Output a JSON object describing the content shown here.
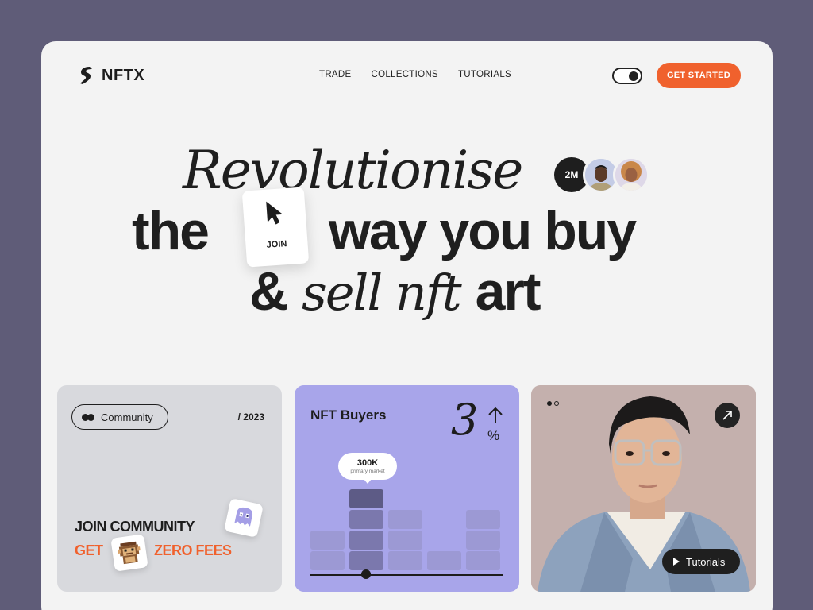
{
  "brand": {
    "name": "NFTX"
  },
  "nav": {
    "items": [
      "TRADE",
      "COLLECTIONS",
      "TUTORIALS"
    ]
  },
  "header": {
    "cta_label": "GET STARTED",
    "theme_toggle_state": "on"
  },
  "hero": {
    "line1": "Revolutionise",
    "line2_start": "the",
    "line2_end": "way you buy",
    "line3_start": "&",
    "line3_italic": "sell nft",
    "line3_end": "art",
    "join_label": "JOIN",
    "users_badge": "2M"
  },
  "community_card": {
    "pill_label": "Community",
    "year": "/ 2023",
    "title": "JOIN COMMUNITY",
    "get": "GET",
    "zero_fees": "ZERO FEES"
  },
  "buyers_card": {
    "title": "NFT Buyers",
    "stat_number": "3",
    "stat_unit": "%",
    "tooltip_value": "300K",
    "tooltip_label": "primary market",
    "columns_blocks": [
      2,
      4,
      3,
      1,
      3
    ],
    "highlight_column": 1,
    "slider_position": 0.29
  },
  "tutorials_card": {
    "button_label": "Tutorials",
    "carousel_index": 0,
    "carousel_count": 2
  },
  "colors": {
    "background": "#5f5c78",
    "accent": "#f0612d",
    "card_community": "#d8d9dd",
    "card_buyers": "#a8a5ea",
    "card_tutorials": "#c4b0ad"
  }
}
